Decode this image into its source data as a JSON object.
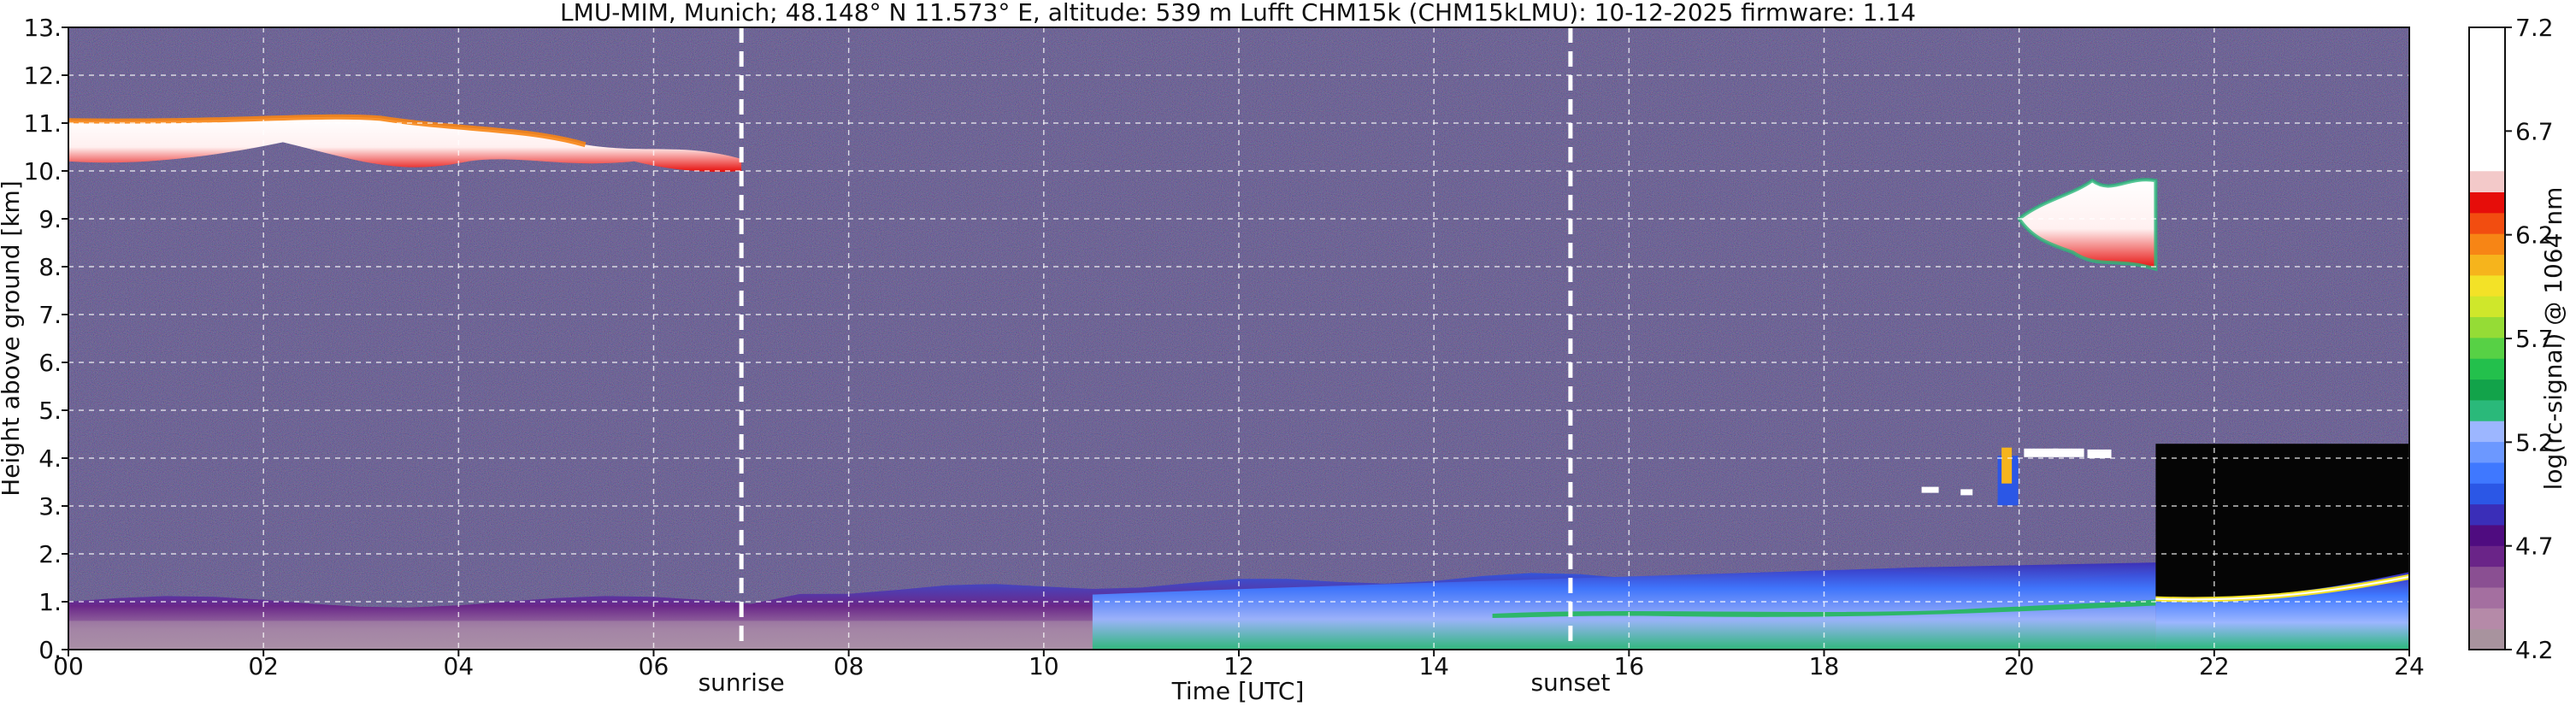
{
  "chart_data": {
    "type": "heatmap",
    "title": "LMU-MIM, Munich; 48.148° N 11.573° E, altitude: 539 m    Lufft CHM15k (CHM15kLMU): 10-12-2025    firmware: 1.14",
    "xlabel": "Time [UTC]",
    "ylabel": "Height above ground [km]",
    "xlim": [
      0,
      24
    ],
    "ylim": [
      0,
      13
    ],
    "x_ticks": [
      "00",
      "02",
      "04",
      "06",
      "08",
      "10",
      "12",
      "14",
      "16",
      "18",
      "20",
      "22",
      "24"
    ],
    "y_ticks": [
      "0.",
      "1.",
      "2.",
      "3.",
      "4.",
      "5.",
      "6.",
      "7.",
      "8.",
      "9.",
      "10.",
      "11.",
      "12.",
      "13."
    ],
    "grid": true,
    "markers": [
      {
        "label": "sunrise",
        "time_utc": 6.9
      },
      {
        "label": "sunset",
        "time_utc": 15.4
      }
    ],
    "colorbar": {
      "label": "log(rc-signal) @ 1064 nm",
      "range": [
        4.2,
        7.2
      ],
      "ticks": [
        "4.2",
        "4.7",
        "5.2",
        "5.7",
        "6.2",
        "6.7",
        "7.2"
      ],
      "colors": [
        "#a8939e",
        "#b58aa8",
        "#a46fa0",
        "#8a4f92",
        "#6a2488",
        "#4f0c80",
        "#3a2eb8",
        "#2b57e6",
        "#3f78ff",
        "#6c98ff",
        "#9cb6ff",
        "#2ab97a",
        "#12a34a",
        "#23c04c",
        "#57d145",
        "#95dc36",
        "#cfe72b",
        "#f3e227",
        "#f6b41c",
        "#f78515",
        "#f24d10",
        "#e60d0a",
        "#f3c9c9",
        "#ffffff"
      ]
    },
    "features": [
      {
        "name": "high cloud",
        "t_start": 0,
        "t_end": 6.9,
        "z_bottom": 9.8,
        "z_top": 11.2
      },
      {
        "name": "cirrus patch",
        "t_start": 20.0,
        "t_end": 21.4,
        "z_bottom": 7.9,
        "z_top": 9.9
      },
      {
        "name": "small cloud echoes",
        "t_start": 19.7,
        "t_end": 21.0,
        "z_bottom": 3.3,
        "z_top": 4.4
      },
      {
        "name": "boundary layer",
        "t_start": 0,
        "t_end": 24,
        "z_bottom": 0,
        "z_top": 1.8
      },
      {
        "name": "data gap",
        "t_start": 21.4,
        "t_end": 24,
        "z_bottom": 1.1,
        "z_top": 4.3
      }
    ]
  }
}
